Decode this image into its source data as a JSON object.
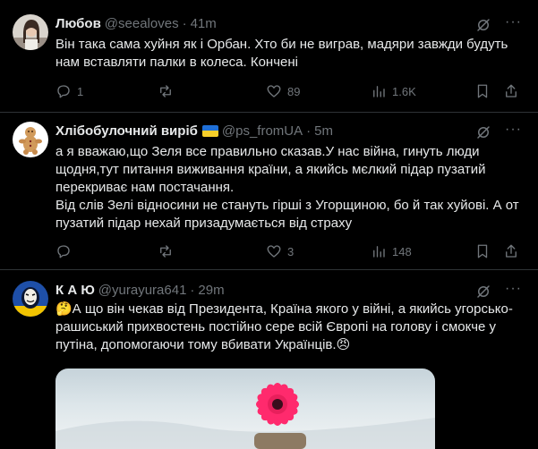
{
  "tweets": [
    {
      "name": "Любов",
      "handle": "@seealoves",
      "separator": "·",
      "time": "41m",
      "text": "Він така сама хуйня як і Орбан. Хто би не виграв, мадяри завжди будуть нам вставляти палки в колеса. Кончені",
      "replies": "1",
      "reposts": "",
      "likes": "89",
      "views": "1.6K",
      "more": "···"
    },
    {
      "name": "Хлібобулочний виріб",
      "handle": "@ps_fromUA",
      "separator": "·",
      "time": "5m",
      "text": "а я вважаю,що Зеля все правильно сказав.У нас війна, гинуть люди щодня,тут питання виживання країни, а якийсь мєлкий підар пузатий перекриває нам постачання.\nВід слів Зелі відносини не стануть гірші з Угорщиною, бо й так хуйові. А от пузатий підар нехай призадумається від страху",
      "replies": "",
      "reposts": "",
      "likes": "3",
      "views": "148",
      "more": "···"
    },
    {
      "name": "К А Ю",
      "handle": "@yurayura641",
      "separator": "·",
      "time": "29m",
      "text": "🤔А що він чекав від Президента, Країна якого у війні, а якийсь угорсько-рашиський прихвостень постійно сере всій Європі на голову і смокче у путіна, допомогаючи тому вбивати Українців.😠",
      "more": "···"
    }
  ]
}
